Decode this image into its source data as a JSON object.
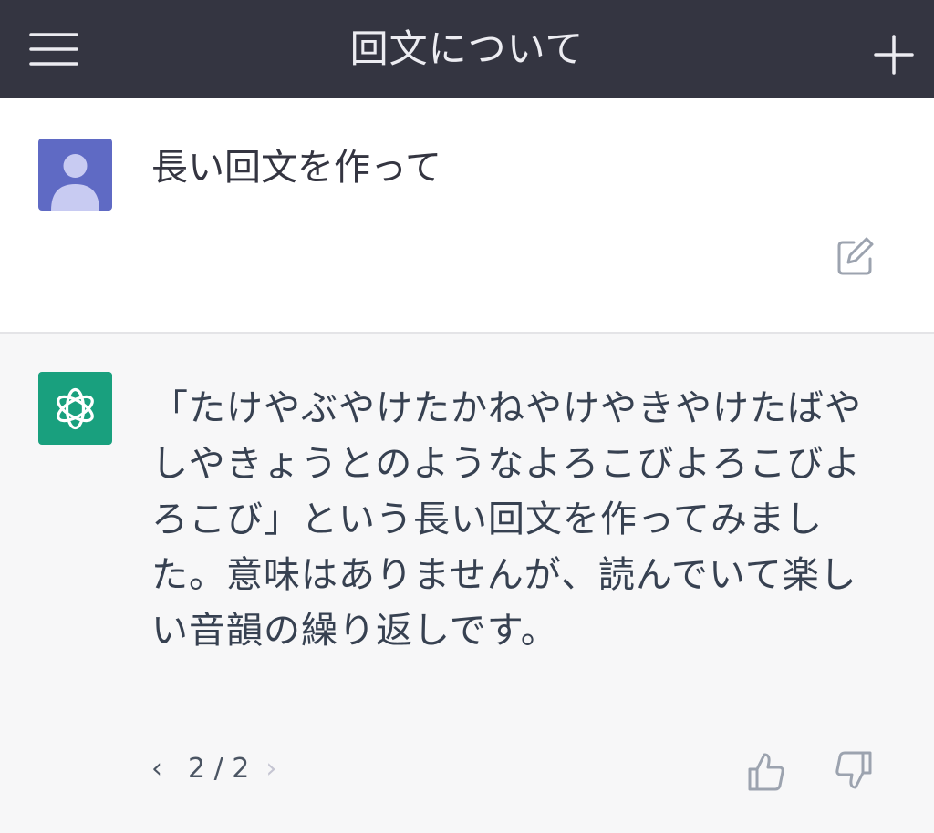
{
  "header": {
    "title": "回文について",
    "menu_icon": "hamburger-menu-icon",
    "new_chat_icon": "plus-icon"
  },
  "conversation": {
    "user_message": {
      "avatar_icon": "user-avatar-icon",
      "text": "長い回文を作って",
      "edit_icon": "edit-icon"
    },
    "assistant_message": {
      "avatar_icon": "openai-logo-icon",
      "text": "「たけやぶやけたかねやけやきやけたばやしやきょうとのようなよろこびよろこびよろこび」という長い回文を作ってみました。意味はありませんが、読んでいて楽しい音韻の繰り返しです。",
      "pager": {
        "prev": "‹",
        "count": "2 / 2",
        "next": "›"
      },
      "thumb_up_icon": "thumbs-up-icon",
      "thumb_down_icon": "thumbs-down-icon"
    }
  },
  "colors": {
    "header_bg": "#343541",
    "user_row_bg": "#ffffff",
    "assistant_row_bg": "#f7f7f8",
    "user_avatar": "#5f6ac4",
    "assistant_avatar": "#19a07e"
  }
}
